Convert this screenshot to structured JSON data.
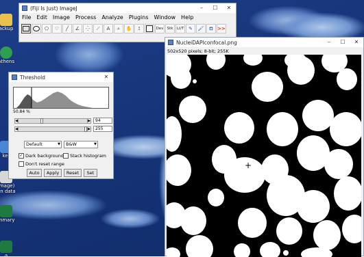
{
  "desktop": {
    "icons": [
      {
        "label": "ackup"
      },
      {
        "label": "Athens"
      },
      {
        "label": "ker"
      },
      {
        "label": "Image)"
      },
      {
        "label": "on data"
      },
      {
        "label": "mmary"
      },
      {
        "label": "a"
      }
    ]
  },
  "imagej": {
    "title": "(Fiji Is Just) ImageJ",
    "menu": [
      "File",
      "Edit",
      "Image",
      "Process",
      "Analyze",
      "Plugins",
      "Window",
      "Help"
    ],
    "tools": [
      "rectangle-tool",
      "oval-tool",
      "polygon-tool",
      "freehand-tool",
      "line-tool",
      "angle-tool",
      "point-tool",
      "wand-tool",
      "text-tool",
      "magnifier-tool",
      "hand-tool",
      "dropper-tool",
      "color-box",
      "Dev",
      "Stk",
      "LUT",
      "pencil-tool",
      "brush-tool",
      "flood-fill-tool",
      "more-tools"
    ],
    "tool_labels": {
      "dev": "Dev",
      "stk": "Stk",
      "lut": "LUT",
      "more": ">>"
    }
  },
  "threshold": {
    "title": "Threshold",
    "percent": "50.84 %",
    "min_value": "94",
    "max_value": "255",
    "method": "Default",
    "mode": "B&W",
    "dark_background_label": "Dark background",
    "dark_background_checked": true,
    "stack_histogram_label": "Stack histogram",
    "stack_histogram_checked": false,
    "dont_reset_label": "Don't reset range",
    "dont_reset_checked": false,
    "buttons": {
      "auto": "Auto",
      "apply": "Apply",
      "reset": "Reset",
      "set": "Set"
    }
  },
  "image_window": {
    "title": "NucleiDAPIconfocal.png",
    "info": "502x520 pixels; 8-bit; 255K"
  },
  "colors": {
    "accent": "#5b7fc0",
    "desktop": "#1d3f8a"
  }
}
